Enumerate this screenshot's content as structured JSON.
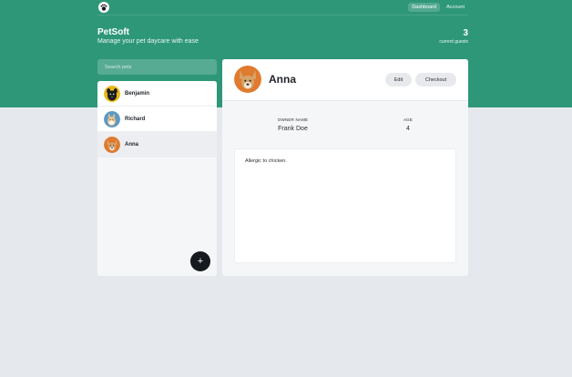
{
  "nav": {
    "logo_icon": "paw-icon",
    "links": [
      {
        "label": "Dashboard",
        "active": true
      },
      {
        "label": "Account",
        "active": false
      }
    ]
  },
  "brand": {
    "title": "PetSoft",
    "subtitle": "Manage your pet daycare with ease"
  },
  "stats": {
    "count": "3",
    "label": "current guests"
  },
  "search": {
    "placeholder": "Search pets",
    "value": ""
  },
  "pets": [
    {
      "name": "Benjamin",
      "avatar_icon": "dog-avatar-icon",
      "selected": false
    },
    {
      "name": "Richard",
      "avatar_icon": "cat-avatar-icon",
      "selected": false
    },
    {
      "name": "Anna",
      "avatar_icon": "dog-avatar-icon",
      "selected": true
    }
  ],
  "add_button": {
    "label": "+"
  },
  "detail": {
    "name": "Anna",
    "edit_label": "Edit",
    "checkout_label": "Checkout",
    "owner_label": "OWNER NAME",
    "owner_value": "Frank Doe",
    "age_label": "AGE",
    "age_value": "4",
    "notes": "Allergic to chicken."
  },
  "colors": {
    "brand": "#2e9778",
    "background": "#e5e8ec",
    "dark_button": "#16191d"
  }
}
